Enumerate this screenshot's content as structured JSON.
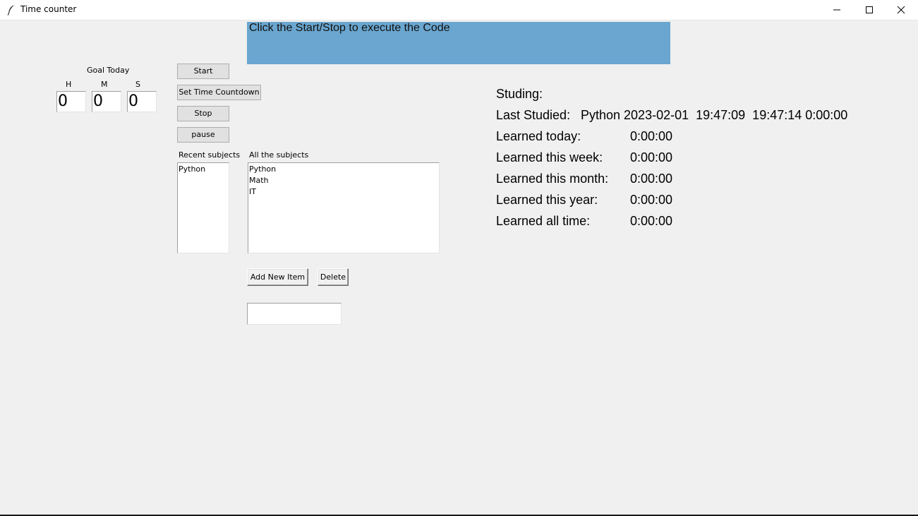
{
  "window": {
    "title": "Time counter",
    "icon": "feather-icon",
    "controls": [
      "minimize-icon",
      "maximize-icon",
      "close-icon"
    ]
  },
  "banner": {
    "text": "Click the Start/Stop to execute the Code",
    "color": "#6aa6cf"
  },
  "goal": {
    "title": "Goal Today",
    "labels": {
      "h": "H",
      "m": "M",
      "s": "S"
    },
    "values": {
      "h": "0",
      "m": "0",
      "s": "0"
    }
  },
  "buttons": {
    "start": "Start",
    "countdown": "Set Time Countdown",
    "stop": "Stop",
    "pause": "pause",
    "add": "Add New Item",
    "delete": "Delete"
  },
  "recent": {
    "label": "Recent subjects",
    "items": [
      "Python"
    ]
  },
  "all": {
    "label": "All the subjects",
    "items": [
      "Python",
      "Math",
      "IT"
    ]
  },
  "new_item_entry": {
    "value": ""
  },
  "stats": {
    "studying_label": "Studing:",
    "last_studied_label": "Last Studied:",
    "last_studied_value": "Python 2023-02-01  19:47:09  19:47:14 0:00:00",
    "today_label": "Learned today:",
    "today_value": "0:00:00",
    "week_label": "Learned this week:",
    "week_value": "0:00:00",
    "month_label": "Learned this month:",
    "month_value": "0:00:00",
    "year_label": "Learned this year:",
    "year_value": "0:00:00",
    "all_label": "Learned all time:",
    "all_value": "0:00:00"
  }
}
